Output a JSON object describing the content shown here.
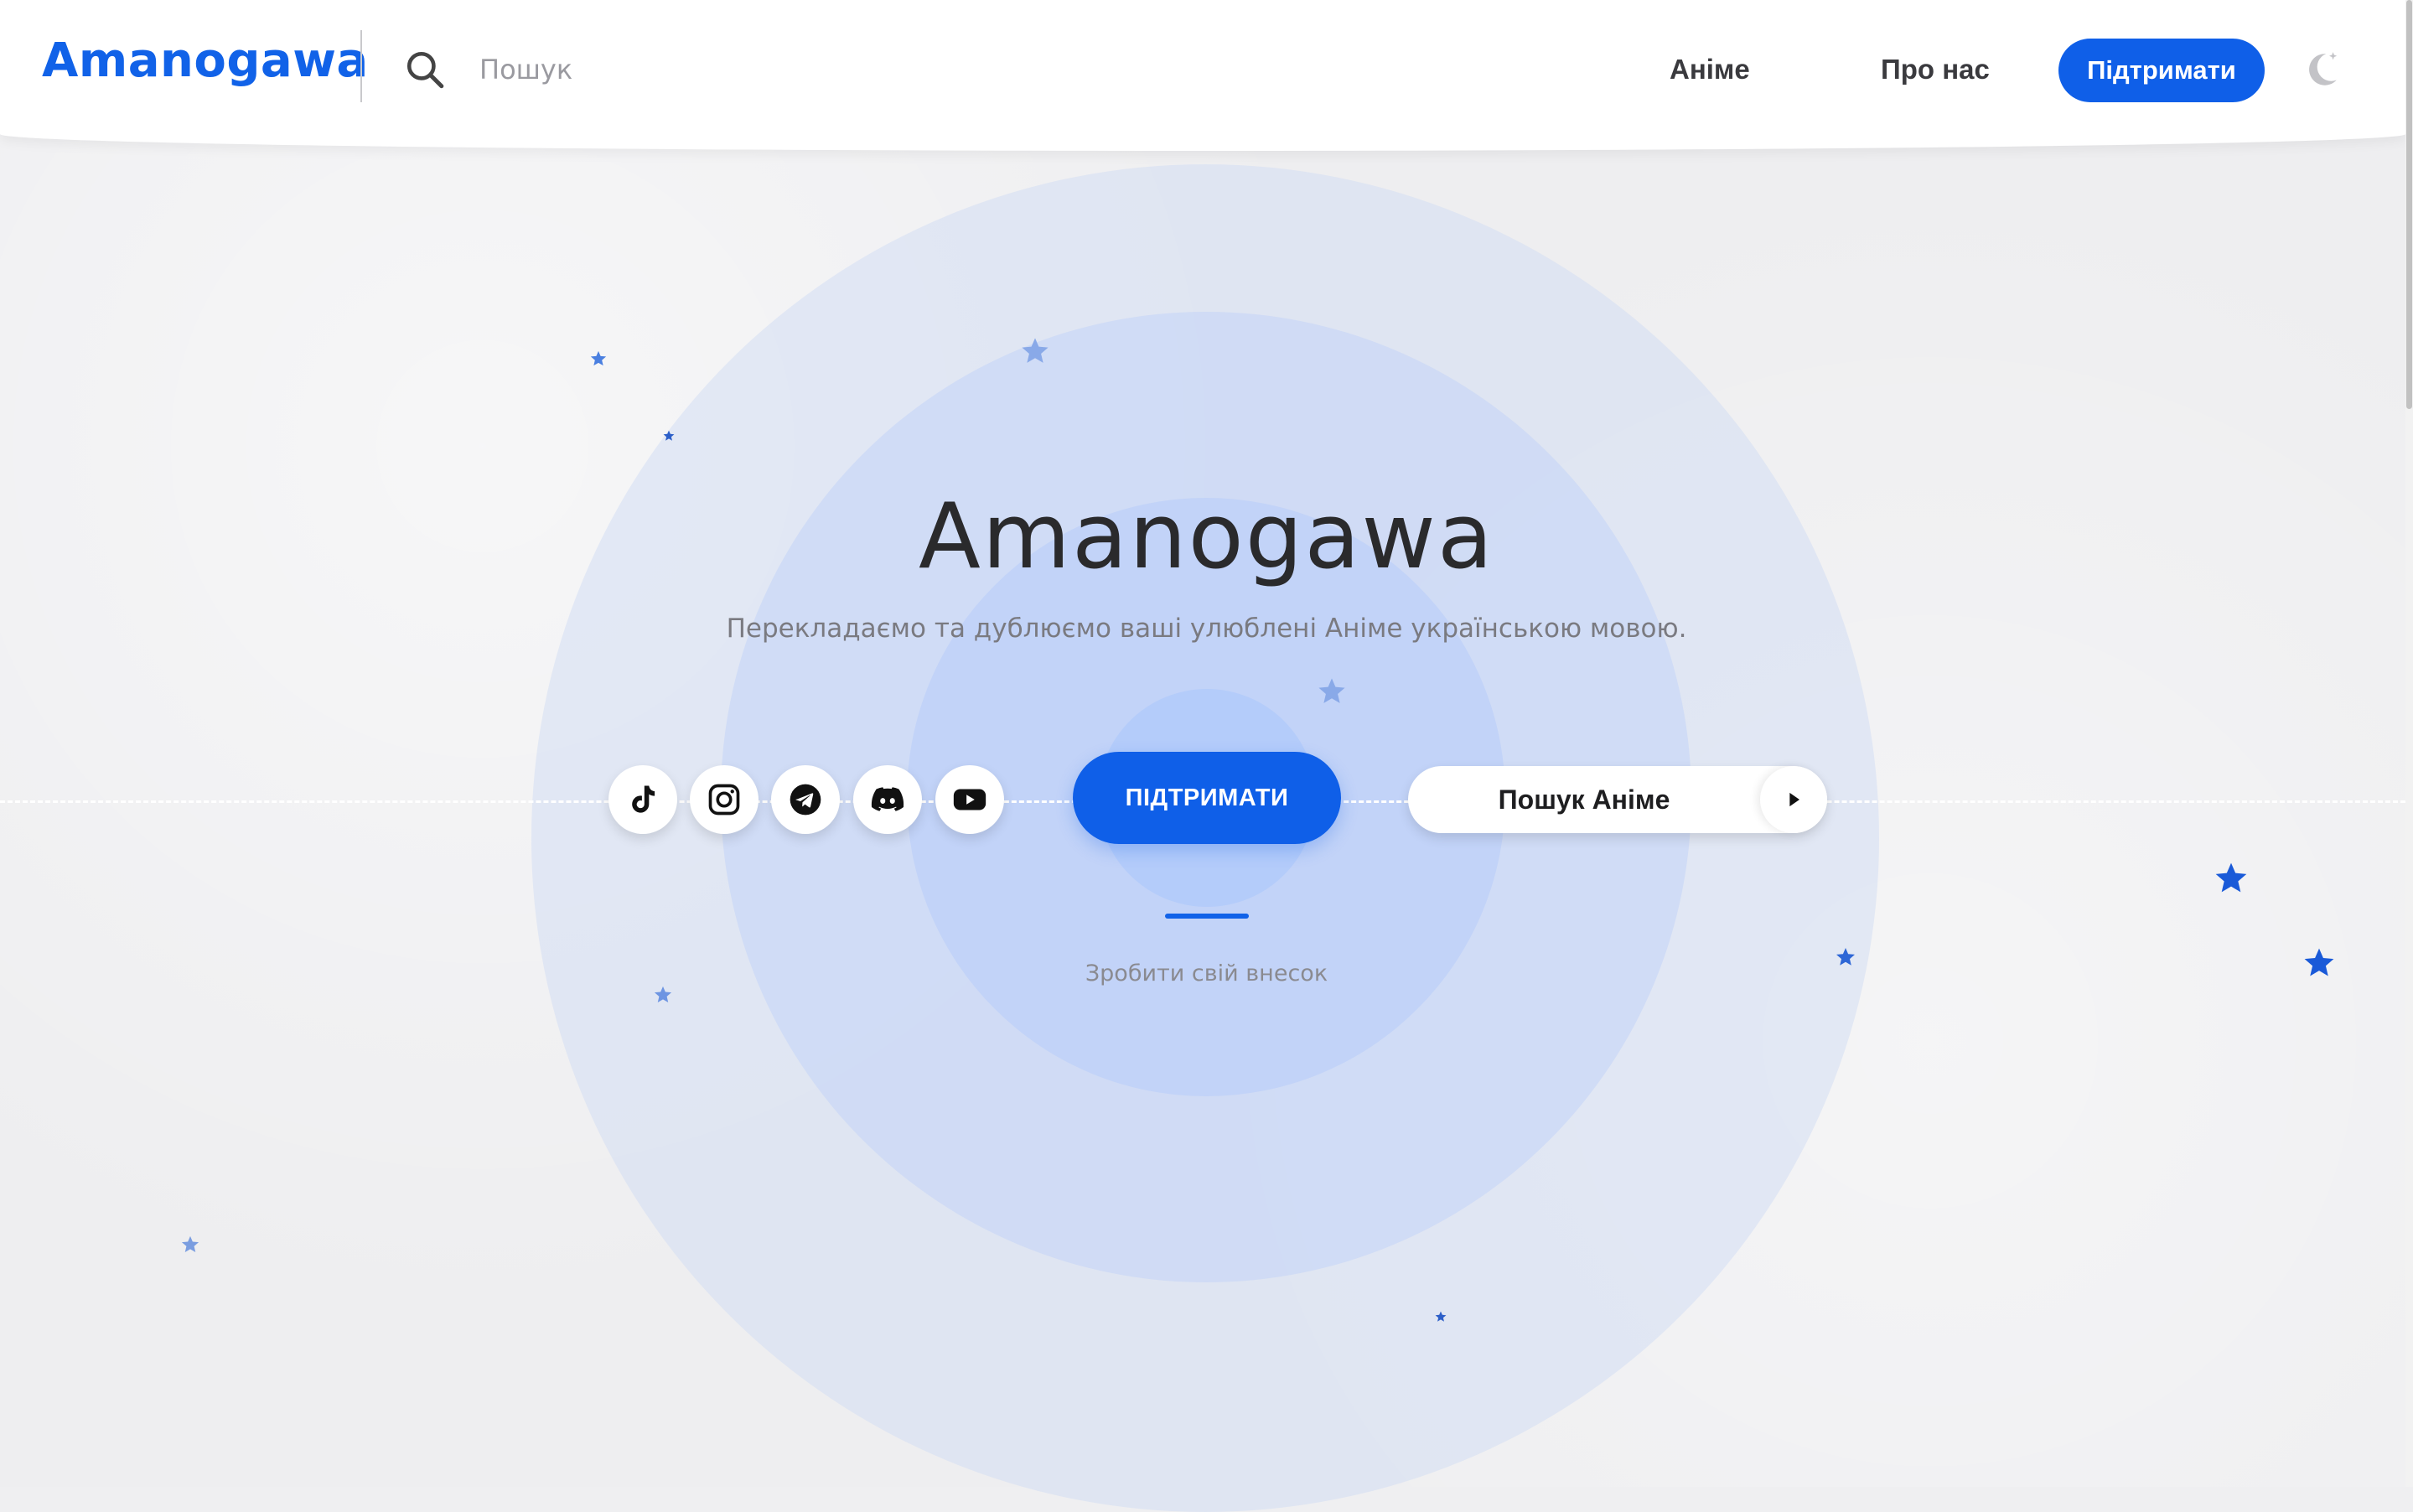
{
  "header": {
    "logo": "Amanogawa",
    "search_placeholder": "Пошук",
    "nav": {
      "anime": "Аніме",
      "about": "Про нас",
      "support": "Підтримати"
    }
  },
  "hero": {
    "title": "Amanogawa",
    "subtitle": "Перекладаємо та дублюємо ваші улюблені Аніме українською мовою.",
    "cta_label": "ПІДТРИМАТИ",
    "cta_caption": "Зробити свій внесок",
    "anime_search_label": "Пошук Аніме"
  },
  "social": [
    "tiktok-icon",
    "instagram-icon",
    "telegram-icon",
    "discord-icon",
    "youtube-icon"
  ],
  "colors": {
    "accent": "#0f5fe8",
    "background": "#eeeef0",
    "text_dark": "#2a2a2c",
    "text_muted": "#7a7a80"
  }
}
